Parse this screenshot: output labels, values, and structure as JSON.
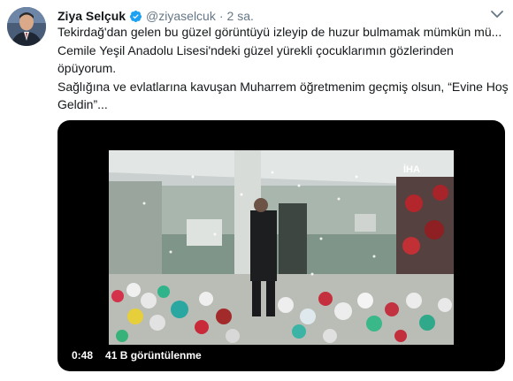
{
  "tweet": {
    "author_name": "Ziya Selçuk",
    "handle": "@ziyaselcuk",
    "separator": "·",
    "time": "2 sa.",
    "lines": [
      "Tekirdağ'dan gelen bu güzel görüntüyü izleyip de huzur bulmamak mümkün mü...",
      "Cemile Yeşil Anadolu Lisesi'ndeki güzel yürekli çocuklarımın gözlerinden",
      "öpüyorum.",
      "Sağlığına ve evlatlarına kavuşan Muharrem öğretmenim geçmiş olsun, “Evine Hoş",
      "Geldin”..."
    ]
  },
  "video": {
    "duration": "0:48",
    "views": "41 B görüntülenme",
    "watermark": "İHA"
  },
  "colors": {
    "verified_blue": "#1da1f2",
    "secondary_text": "#657786"
  }
}
